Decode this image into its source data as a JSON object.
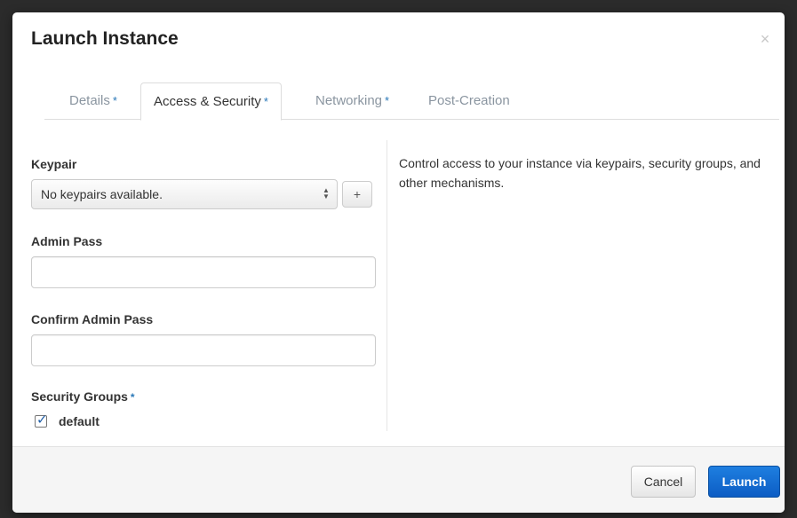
{
  "modal": {
    "title": "Launch Instance",
    "close_glyph": "×"
  },
  "tabs": [
    {
      "label": "Details",
      "required": "*"
    },
    {
      "label": "Access & Security",
      "required": "*"
    },
    {
      "label": "Networking",
      "required": "*"
    },
    {
      "label": "Post-Creation",
      "required": ""
    }
  ],
  "active_tab": "Access & Security",
  "form": {
    "keypair": {
      "label": "Keypair",
      "selected": "No keypairs available.",
      "add_button": "+"
    },
    "admin_pass": {
      "label": "Admin Pass",
      "value": "",
      "placeholder": ""
    },
    "confirm_admin_pass": {
      "label": "Confirm Admin Pass",
      "value": "",
      "placeholder": ""
    },
    "security_groups": {
      "label": "Security Groups",
      "required": "*",
      "options": [
        {
          "label": "default",
          "checked": true
        }
      ]
    }
  },
  "help": {
    "text": "Control access to your instance via keypairs, security groups, and other mechanisms."
  },
  "footer": {
    "cancel_label": "Cancel",
    "launch_label": "Launch"
  },
  "colors": {
    "primary": "#0c5dc4",
    "required_marker": "#2a78b8",
    "inactive_tab": "#8a95a0"
  },
  "icons": {
    "close": "close-icon",
    "select_arrows": "select-arrows-icon",
    "checkbox": "checkmark-icon"
  }
}
